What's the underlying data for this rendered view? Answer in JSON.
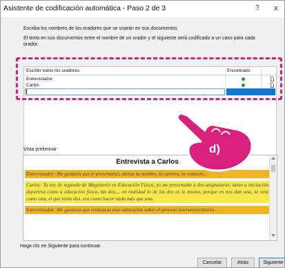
{
  "window": {
    "title": "Asistente de codificación automática - Paso 2 de 3",
    "help_glyph": "?",
    "close_glyph": "x"
  },
  "instructions": {
    "line1": "Escriba los nombres de los oradores que se usarán en sus documentos.",
    "line2": "El texto en sus documentos entre el nombre de un orador y el siguiente será codificado a un caso para cada orador."
  },
  "speaker_table": {
    "headers": {
      "speaker": "Escribir todos los oradores",
      "found": "Encontrado"
    },
    "rows": [
      {
        "name": "Entrevistador",
        "found": true
      },
      {
        "name": "Carlos",
        "found": true
      }
    ],
    "new_entry_value": ""
  },
  "preview": {
    "label": "Vista preliminar",
    "title": "Entrevista a Carlos",
    "paragraphs": [
      {
        "speaker": "Entrevistador:",
        "text": " Me gustaría que te presentaras, dieras tu nombre, tu carrera, tu contexto..."
      },
      {
        "speaker": "Carlos:",
        "text": " Yo soy de segundo de Magisterio en Educación Física, yo me presentaba a dos asignaturas: tanto a iniciación deportiva como a educación física, las dos,... en realidad lo de las dos es lo mismo, porque en nos dan una, se veía como una, el que tenía dos, era como hacer nada más que una."
      },
      {
        "speaker": "Entrevistador:",
        "text": " Me gustaría que realizaras una valoración sobre el proceso interuniversitario..."
      }
    ]
  },
  "footer": {
    "hint": "Haga clic en Siguiente para continuar.",
    "buttons": {
      "cancel": "Cancelar",
      "back": "Atrás",
      "next": "Siguiente"
    }
  },
  "annotation": {
    "step_label": "d)",
    "colors": {
      "highlight": "#d8217c",
      "hand": "#d8217c"
    }
  },
  "colors": {
    "speaker_highlight": "#f0b323",
    "speech_highlight": "#f7e84c",
    "selected_cell": "#1176d4",
    "found_check": "#2a9a2a"
  }
}
